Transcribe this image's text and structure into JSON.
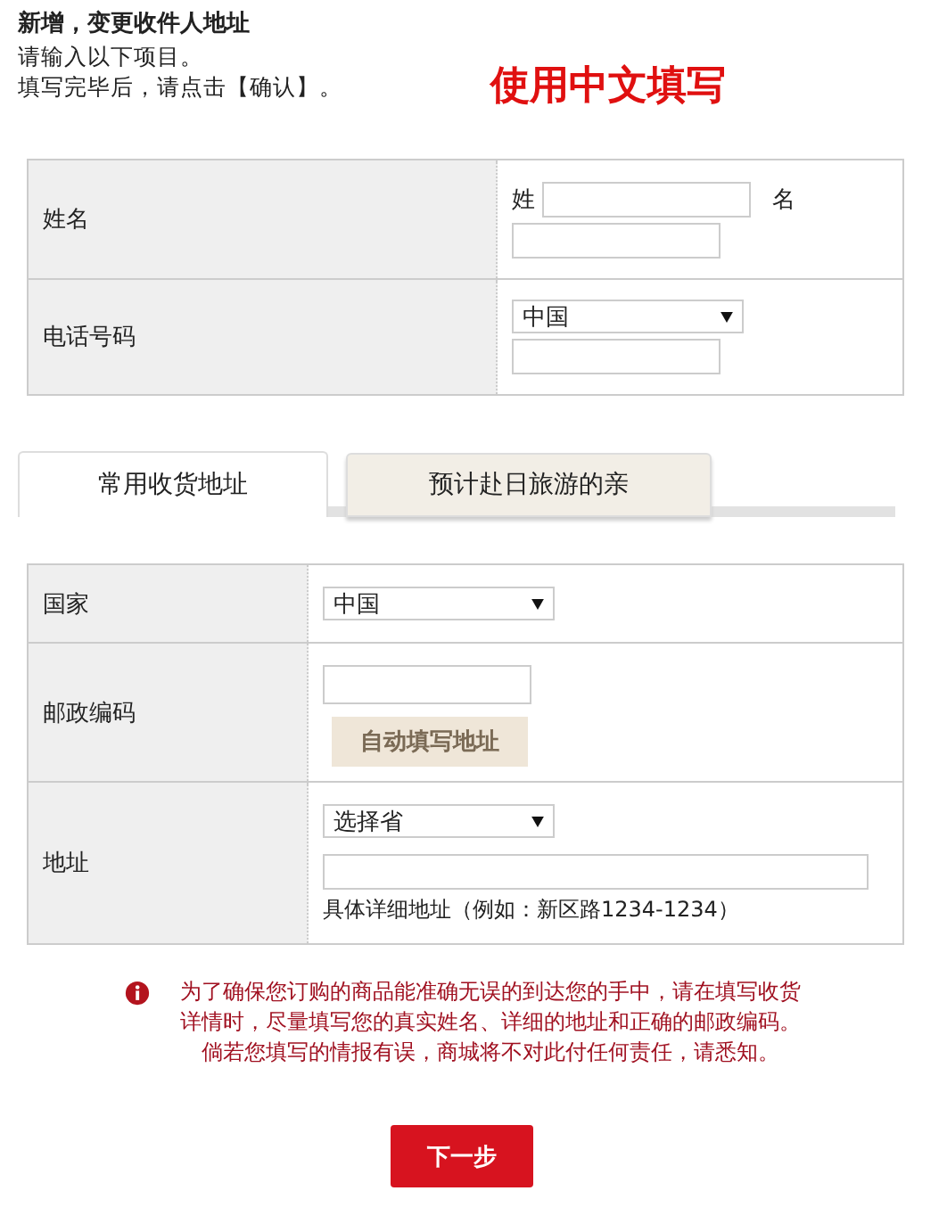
{
  "header": {
    "title": "新增，变更收件人地址",
    "instructions": [
      "请输入以下项目。",
      "填写完毕后，请点击【确认】。"
    ],
    "notice": "使用中文填写"
  },
  "name_table": {
    "rows": [
      {
        "label": "姓名",
        "kind": "name",
        "surname_label": "姓",
        "given_label": "名"
      },
      {
        "label": "电话号码",
        "kind": "phone",
        "select_value": "中国"
      }
    ]
  },
  "tabs": [
    {
      "label": "常用收货地址",
      "selected": true
    },
    {
      "label": "预计赴日旅游的亲",
      "selected": false
    }
  ],
  "address_table": {
    "rows": [
      {
        "label": "国家",
        "kind": "select",
        "select_value": "中国"
      },
      {
        "label": "邮政编码",
        "kind": "postcode",
        "button": "自动填写地址"
      },
      {
        "label": "地址",
        "kind": "address",
        "select_value": "选择省",
        "hint": "具体详细地址（例如：新区路1234-1234）"
      }
    ]
  },
  "warning": {
    "lines": [
      "为了确保您订购的商品能准确无误的到达您的手中，请在填写收货",
      "详情时，尽量填写您的真实姓名、详细的地址和正确的邮政编码。",
      "倘若您填写的情报有误，商城将不对此付任何责任，请悉知。"
    ]
  },
  "next_button": "下一步"
}
